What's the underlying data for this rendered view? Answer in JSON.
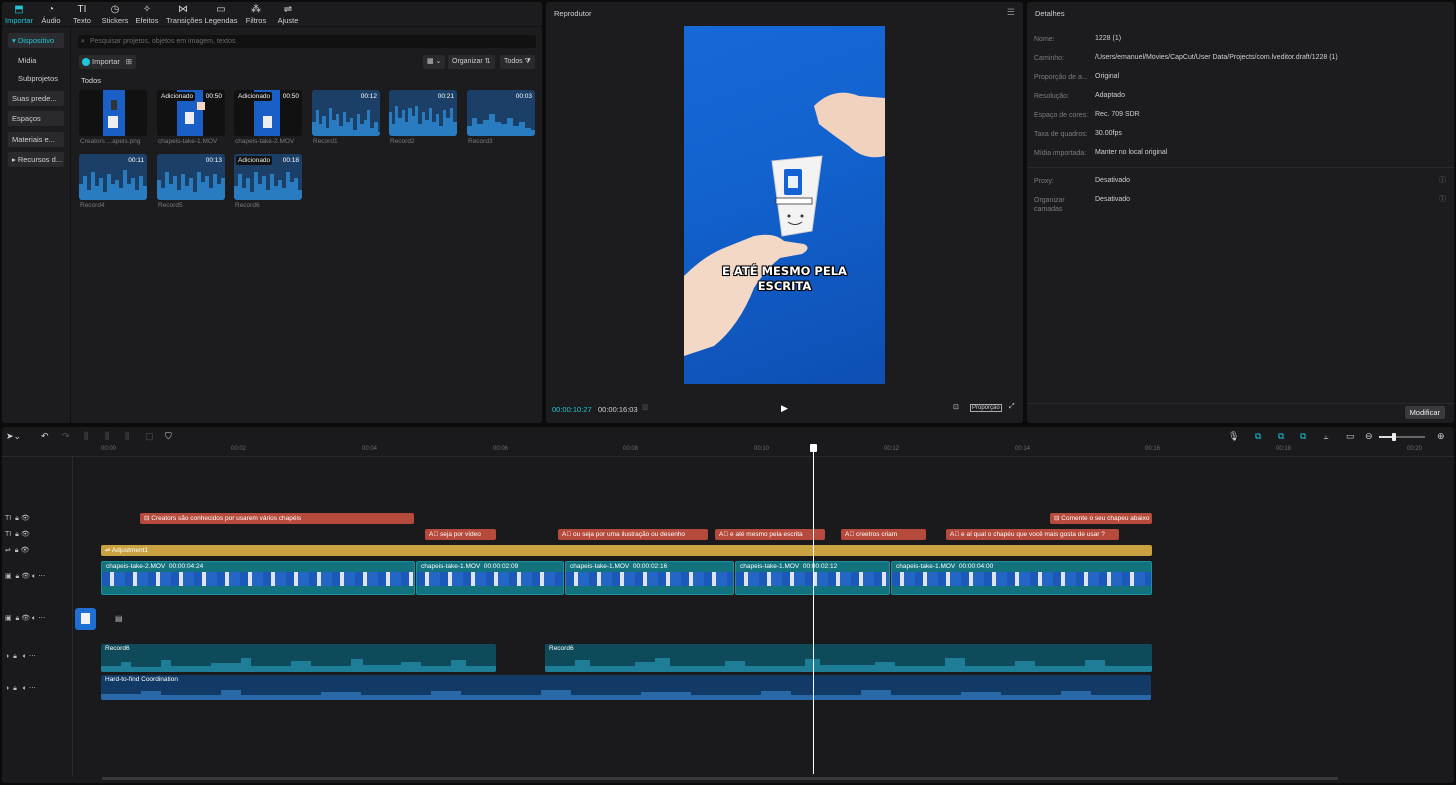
{
  "media_panel": {
    "tabs": [
      {
        "label": "Importar",
        "icon": "import-icon"
      },
      {
        "label": "Áudio",
        "icon": "audio-icon"
      },
      {
        "label": "Texto",
        "icon": "text-icon"
      },
      {
        "label": "Stickers",
        "icon": "sticker-icon"
      },
      {
        "label": "Efeitos",
        "icon": "effects-icon"
      },
      {
        "label": "Transições",
        "icon": "transitions-icon"
      },
      {
        "label": "Legendas",
        "icon": "captions-icon"
      },
      {
        "label": "Filtros",
        "icon": "filters-icon"
      },
      {
        "label": "Ajuste",
        "icon": "adjust-icon"
      }
    ],
    "nav": [
      {
        "label": "▾ Dispositivo"
      },
      {
        "label": "Mídia"
      },
      {
        "label": "Subprojetos"
      },
      {
        "label": "Suas prede..."
      },
      {
        "label": "Espaços"
      },
      {
        "label": "Materiais e..."
      },
      {
        "label": "▸ Recursos d..."
      }
    ],
    "search_placeholder": "Pesquisar projetos, objetos em imagem, textos",
    "import_label": "Importar",
    "organize_label": "Organizar",
    "filter_label": "Todos",
    "section_label": "Todos",
    "items": [
      {
        "name": "Creators ...apeis.png",
        "duration": "",
        "badge": ""
      },
      {
        "name": "chapeis-take-1.MOV",
        "duration": "00:50",
        "badge": "Adicionado"
      },
      {
        "name": "chapeis-take-2.MOV",
        "duration": "00:50",
        "badge": "Adicionado"
      },
      {
        "name": "Record1",
        "duration": "00:12",
        "badge": ""
      },
      {
        "name": "Record2",
        "duration": "00:21",
        "badge": ""
      },
      {
        "name": "Record3",
        "duration": "00:03",
        "badge": ""
      },
      {
        "name": "Record4",
        "duration": "00:11",
        "badge": ""
      },
      {
        "name": "Record5",
        "duration": "00:13",
        "badge": ""
      },
      {
        "name": "Record6",
        "duration": "00:18",
        "badge": "Adicionado"
      }
    ]
  },
  "player": {
    "title": "Reprodutor",
    "caption_line1": "E ATÉ MESMO PELA",
    "caption_line2": "ESCRITA",
    "current_time": "00:00:10:27",
    "total_time": "00:00:16:03",
    "ratio_label": "Proporção"
  },
  "details": {
    "title": "Detalhes",
    "rows": [
      {
        "key": "Nome:",
        "value": "1228 (1)"
      },
      {
        "key": "Caminho:",
        "value": "/Users/emanuel/Movies/CapCut/User Data/Projects/com.lveditor.draft/1228 (1)"
      },
      {
        "key": "Proporção de a...",
        "value": "Original"
      },
      {
        "key": "Resolução:",
        "value": "Adaptado"
      },
      {
        "key": "Espaço de cores:",
        "value": "Rec. 709 SDR"
      },
      {
        "key": "Taxa de quadros:",
        "value": "30.00fps"
      },
      {
        "key": "Mídia importada:",
        "value": "Manter no local original"
      }
    ],
    "proxy_key": "Proxy:",
    "proxy_value": "Desativado",
    "layers_key": "Organizar camadas",
    "layers_value": "Desativado",
    "modify_label": "Modificar"
  },
  "timeline": {
    "ruler": [
      "00:00",
      "00:02",
      "00:04",
      "00:06",
      "00:08",
      "00:10",
      "00:12",
      "00:14",
      "00:16",
      "00:18",
      "00:20"
    ],
    "text_track1": [
      "Creators são conhecidos por usarem vários chapéis",
      "Comente o seu chapeu abaixo"
    ],
    "text_track2": [
      "seja por vídeo",
      "ou seja por uma ilustração ou desenho",
      "e até mesmo pela escrita",
      "creetros criam",
      "e aí qual o chapéu que você mais gosta de usar ?"
    ],
    "adjustment": "Adjustment1",
    "video_clips": [
      {
        "name": "chapeis-take-2.MOV",
        "time": "00:00:04:24"
      },
      {
        "name": "chapeis-take-1.MOV",
        "time": "00:00:02:09"
      },
      {
        "name": "chapeis-take-1.MOV",
        "time": "00:00:02:16"
      },
      {
        "name": "chapeis-take-1.MOV",
        "time": "00:00:02:12"
      },
      {
        "name": "chapeis-take-1.MOV",
        "time": "00:00:04:00"
      }
    ],
    "audio1": [
      "Record6",
      "Record6"
    ],
    "audio2": "Hard-to-find Coordination"
  }
}
